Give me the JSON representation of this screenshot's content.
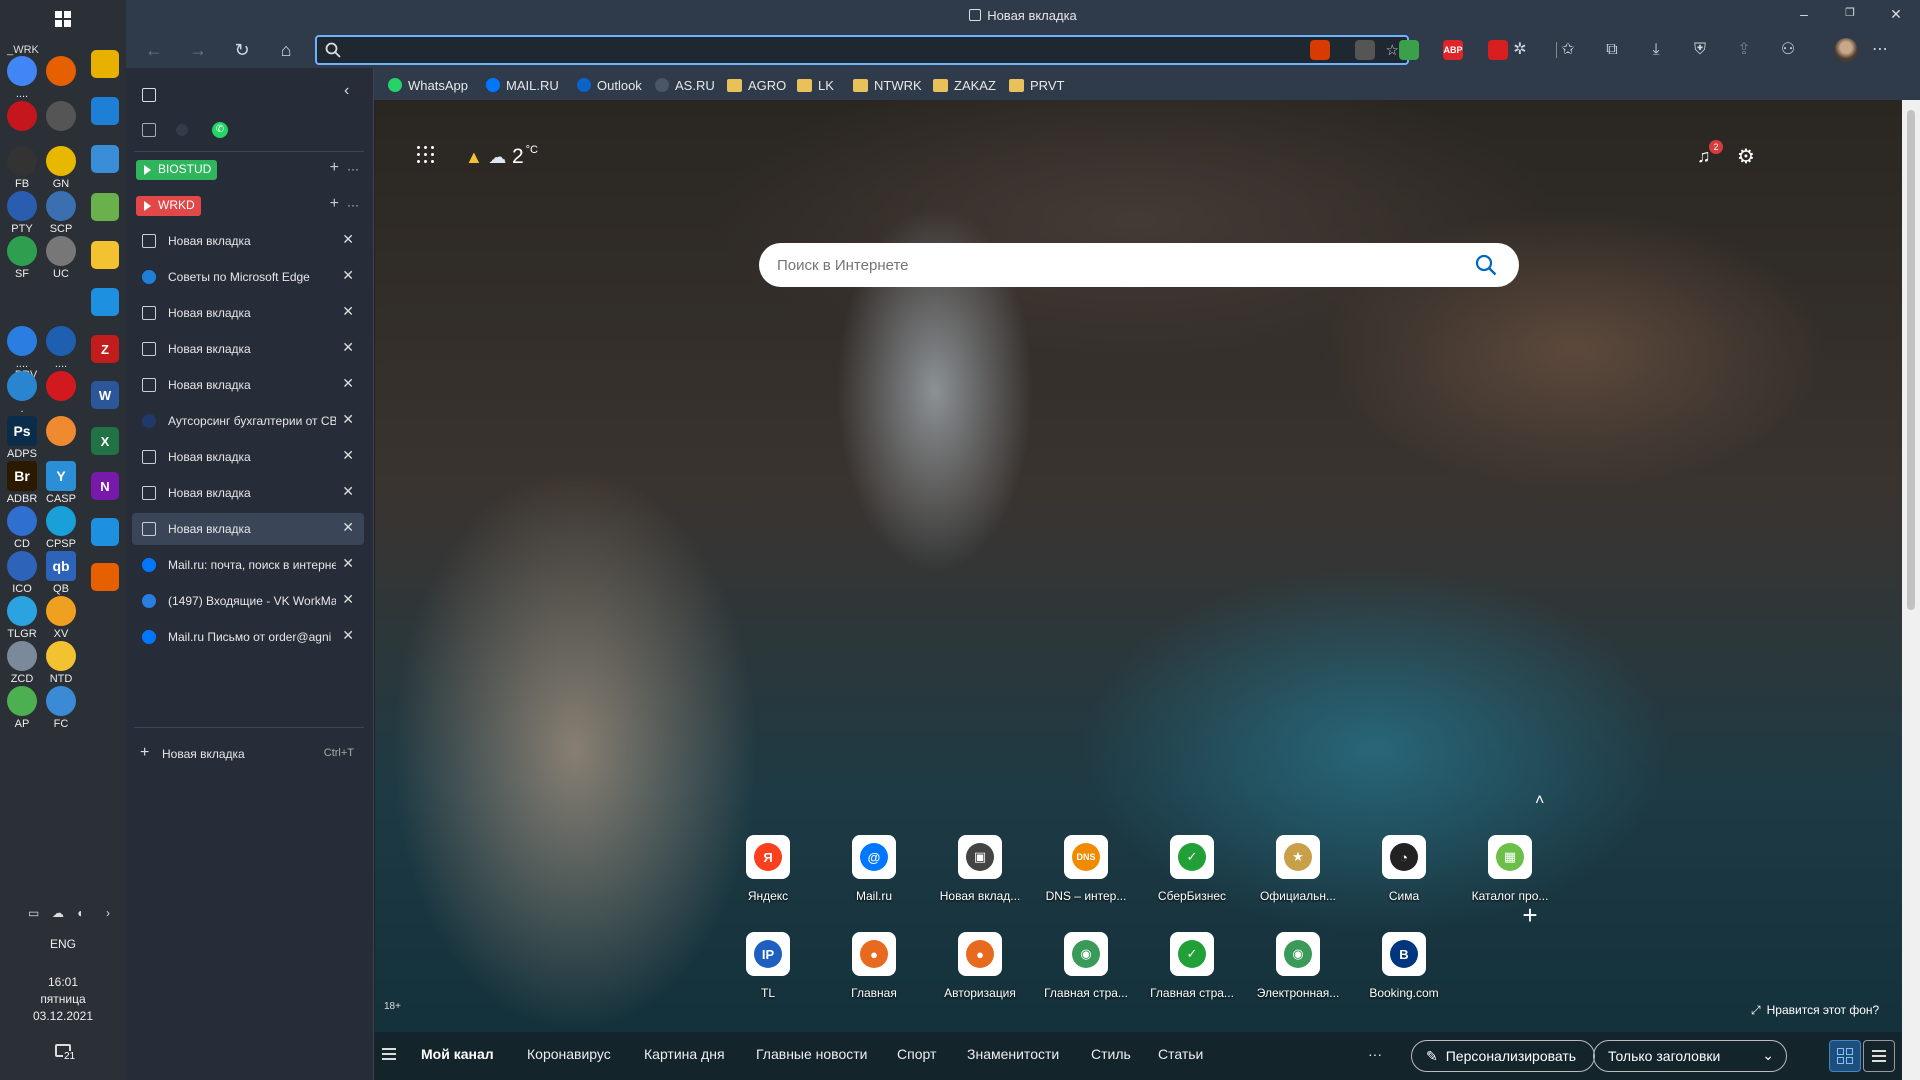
{
  "browser": {
    "window_title": "Новая вкладка",
    "address_value": "",
    "bookmarks": [
      {
        "label": "WhatsApp",
        "icon": "whatsapp-icon"
      },
      {
        "label": "MAIL.RU",
        "icon": "mailru-icon"
      },
      {
        "label": "Outlook",
        "icon": "outlook-icon"
      },
      {
        "label": "AS.RU",
        "icon": "asru-icon"
      },
      {
        "label": "AGRO",
        "icon": "folder-icon"
      },
      {
        "label": "LK",
        "icon": "folder-icon"
      },
      {
        "label": "NTWRK",
        "icon": "folder-icon"
      },
      {
        "label": "ZAKAZ",
        "icon": "folder-icon"
      },
      {
        "label": "PRVT",
        "icon": "folder-icon"
      }
    ],
    "extensions": [
      {
        "icon": "office-icon",
        "color": "#d83b01",
        "text": ""
      },
      {
        "icon": "extension-gray-icon",
        "color": "#555",
        "text": ""
      },
      {
        "icon": "download-green-icon",
        "color": "#3aa04a",
        "text": ""
      },
      {
        "icon": "adblock-icon",
        "color": "#e0252a",
        "text": "ABP"
      },
      {
        "icon": "opera-red-icon",
        "color": "#d81e1e",
        "text": ""
      }
    ]
  },
  "sidebar": {
    "groups": [
      {
        "label": "BIOSTUD",
        "color": "#2fb55c"
      },
      {
        "label": "WRKD",
        "color": "#e34848"
      }
    ],
    "tabs": [
      {
        "title": "Новая вкладка",
        "icon": "newtab-icon",
        "active": false
      },
      {
        "title": "Советы по Microsoft Edge",
        "icon": "edge-icon",
        "active": false
      },
      {
        "title": "Новая вкладка",
        "icon": "newtab-icon",
        "active": false
      },
      {
        "title": "Новая вкладка",
        "icon": "newtab-icon",
        "active": false
      },
      {
        "title": "Новая вкладка",
        "icon": "newtab-icon",
        "active": false
      },
      {
        "title": "Аутсорсинг бухгалтерии от СВ",
        "icon": "site-icon",
        "active": false
      },
      {
        "title": "Новая вкладка",
        "icon": "newtab-icon",
        "active": false
      },
      {
        "title": "Новая вкладка",
        "icon": "newtab-icon",
        "active": false
      },
      {
        "title": "Новая вкладка",
        "icon": "newtab-icon",
        "active": true
      },
      {
        "title": "Mail.ru: почта, поиск в интерне",
        "icon": "mailru-icon",
        "active": false
      },
      {
        "title": "(1497) Входящие - VK WorkMa",
        "icon": "vk-workmail-icon",
        "active": false
      },
      {
        "title": "Mail.ru Письмо от order@agni",
        "icon": "mailru-icon",
        "active": false
      }
    ],
    "new_tab_label": "Новая вкладка",
    "new_tab_shortcut": "Ctrl+T"
  },
  "taskbar": {
    "labels_top": "_WRK",
    "labels_mid": "_PRV",
    "icons": [
      {
        "label": "....",
        "color": "#4285f4",
        "text": ""
      },
      {
        "label": "",
        "color": "#e66000",
        "text": ""
      },
      {
        "label": "",
        "color": "#c4161c",
        "text": ""
      },
      {
        "label": "",
        "color": "#555555",
        "text": ""
      },
      {
        "label": "FB",
        "color": "#333333",
        "text": ""
      },
      {
        "label": "GN",
        "color": "#e8b800",
        "text": ""
      },
      {
        "label": "PTY",
        "color": "#2a5db0",
        "text": ""
      },
      {
        "label": "SCP",
        "color": "#3a6fb0",
        "text": ""
      },
      {
        "label": "SF",
        "color": "#2e9f4f",
        "text": ""
      },
      {
        "label": "UC",
        "color": "#777777",
        "text": ""
      },
      {
        "label": "....",
        "color": "#2a7de1",
        "text": ""
      },
      {
        "label": "....",
        "color": "#1e5fb0",
        "text": ""
      },
      {
        "label": ".",
        "color": "#2a85d0",
        "text": ""
      },
      {
        "label": "",
        "color": "#d31920",
        "text": ""
      },
      {
        "label": "ADPS",
        "color": "#0b2d4c",
        "text": "Ps"
      },
      {
        "label": "",
        "color": "#f08a30",
        "text": ""
      },
      {
        "label": "ADBR",
        "color": "#2b1a00",
        "text": "Br"
      },
      {
        "label": "CASP",
        "color": "#2a8fd6",
        "text": "Y"
      },
      {
        "label": "CD",
        "color": "#2f6fd0",
        "text": ""
      },
      {
        "label": "CPSP",
        "color": "#1aa0d8",
        "text": ""
      },
      {
        "label": "ICO",
        "color": "#2d63b8",
        "text": ""
      },
      {
        "label": "QB",
        "color": "#2d63b8",
        "text": "qb"
      },
      {
        "label": "TLGR",
        "color": "#2aa3e0",
        "text": ""
      },
      {
        "label": "XV",
        "color": "#f0a020",
        "text": ""
      },
      {
        "label": "ZCD",
        "color": "#7a8a9a",
        "text": ""
      },
      {
        "label": "NTD",
        "color": "#f2c230",
        "text": ""
      },
      {
        "label": "AP",
        "color": "#4caf50",
        "text": ""
      },
      {
        "label": "FC",
        "color": "#3a8ad6",
        "text": ""
      }
    ],
    "side_icons": [
      {
        "icon": "acrobat-icon",
        "color": "#e8b000",
        "text": ""
      },
      {
        "icon": "edge-icon",
        "color": "#1e7fd6",
        "text": ""
      },
      {
        "icon": "ruler-icon",
        "color": "#3a8ed8",
        "text": ""
      },
      {
        "icon": "notepad-icon",
        "color": "#6ab04c",
        "text": ""
      },
      {
        "icon": "explorer-icon",
        "color": "#f2c230",
        "text": ""
      },
      {
        "icon": "mail-icon",
        "color": "#1e90e0",
        "text": ""
      },
      {
        "icon": "filezilla-icon",
        "color": "#c21d1d",
        "text": "Z"
      },
      {
        "icon": "word-icon",
        "color": "#2b579a",
        "text": "W"
      },
      {
        "icon": "excel-icon",
        "color": "#217346",
        "text": "X"
      },
      {
        "icon": "onenote-icon",
        "color": "#7719aa",
        "text": "N"
      },
      {
        "icon": "camera-icon",
        "color": "#1e90e0",
        "text": ""
      },
      {
        "icon": "firefox-icon",
        "color": "#e66000",
        "text": ""
      }
    ],
    "language": "ENG",
    "time": "16:01",
    "weekday": "пятница",
    "date": "03.12.2021",
    "notifications": "21"
  },
  "newtab": {
    "temperature": "2",
    "temp_unit": "°C",
    "notification_count": "2",
    "search_placeholder": "Поиск в Интернете",
    "age_rating": "18+",
    "like_background": "Нравится этот фон?",
    "tiles_row1": [
      {
        "label": "Яндекс",
        "color": "#fc3f1d",
        "text": "Я"
      },
      {
        "label": "Mail.ru",
        "color": "#0077ff",
        "text": "@"
      },
      {
        "label": "Новая вклад...",
        "color": "#444444",
        "text": "▣"
      },
      {
        "label": "DNS – интер...",
        "color": "#f28a00",
        "text": "DNS"
      },
      {
        "label": "СберБизнес",
        "color": "#21a038",
        "text": "✓"
      },
      {
        "label": "Официальн...",
        "color": "#c8a04a",
        "text": "★"
      },
      {
        "label": "Сима",
        "color": "#222222",
        "text": "◔"
      },
      {
        "label": "Каталог про...",
        "color": "#6cc04a",
        "text": "▦"
      }
    ],
    "tiles_row2": [
      {
        "label": "TL",
        "color": "#1f5fbf",
        "text": "IP"
      },
      {
        "label": "Главная",
        "color": "#e86a1f",
        "text": "●"
      },
      {
        "label": "Авторизация",
        "color": "#e86a1f",
        "text": "●"
      },
      {
        "label": "Главная стра...",
        "color": "#3a9a5a",
        "text": "◉"
      },
      {
        "label": "Главная стра...",
        "color": "#21a038",
        "text": "✓"
      },
      {
        "label": "Электронная...",
        "color": "#3a9a5a",
        "text": "◉"
      },
      {
        "label": "Booking.com",
        "color": "#003580",
        "text": "B"
      }
    ],
    "feed_items": [
      "Мой канал",
      "Коронавирус",
      "Картина дня",
      "Главные новости",
      "Спорт",
      "Знаменитости",
      "Стиль",
      "Статьи"
    ],
    "more_dots": "···",
    "personalize_label": "Персонализировать",
    "headings_only_label": "Только заголовки"
  }
}
